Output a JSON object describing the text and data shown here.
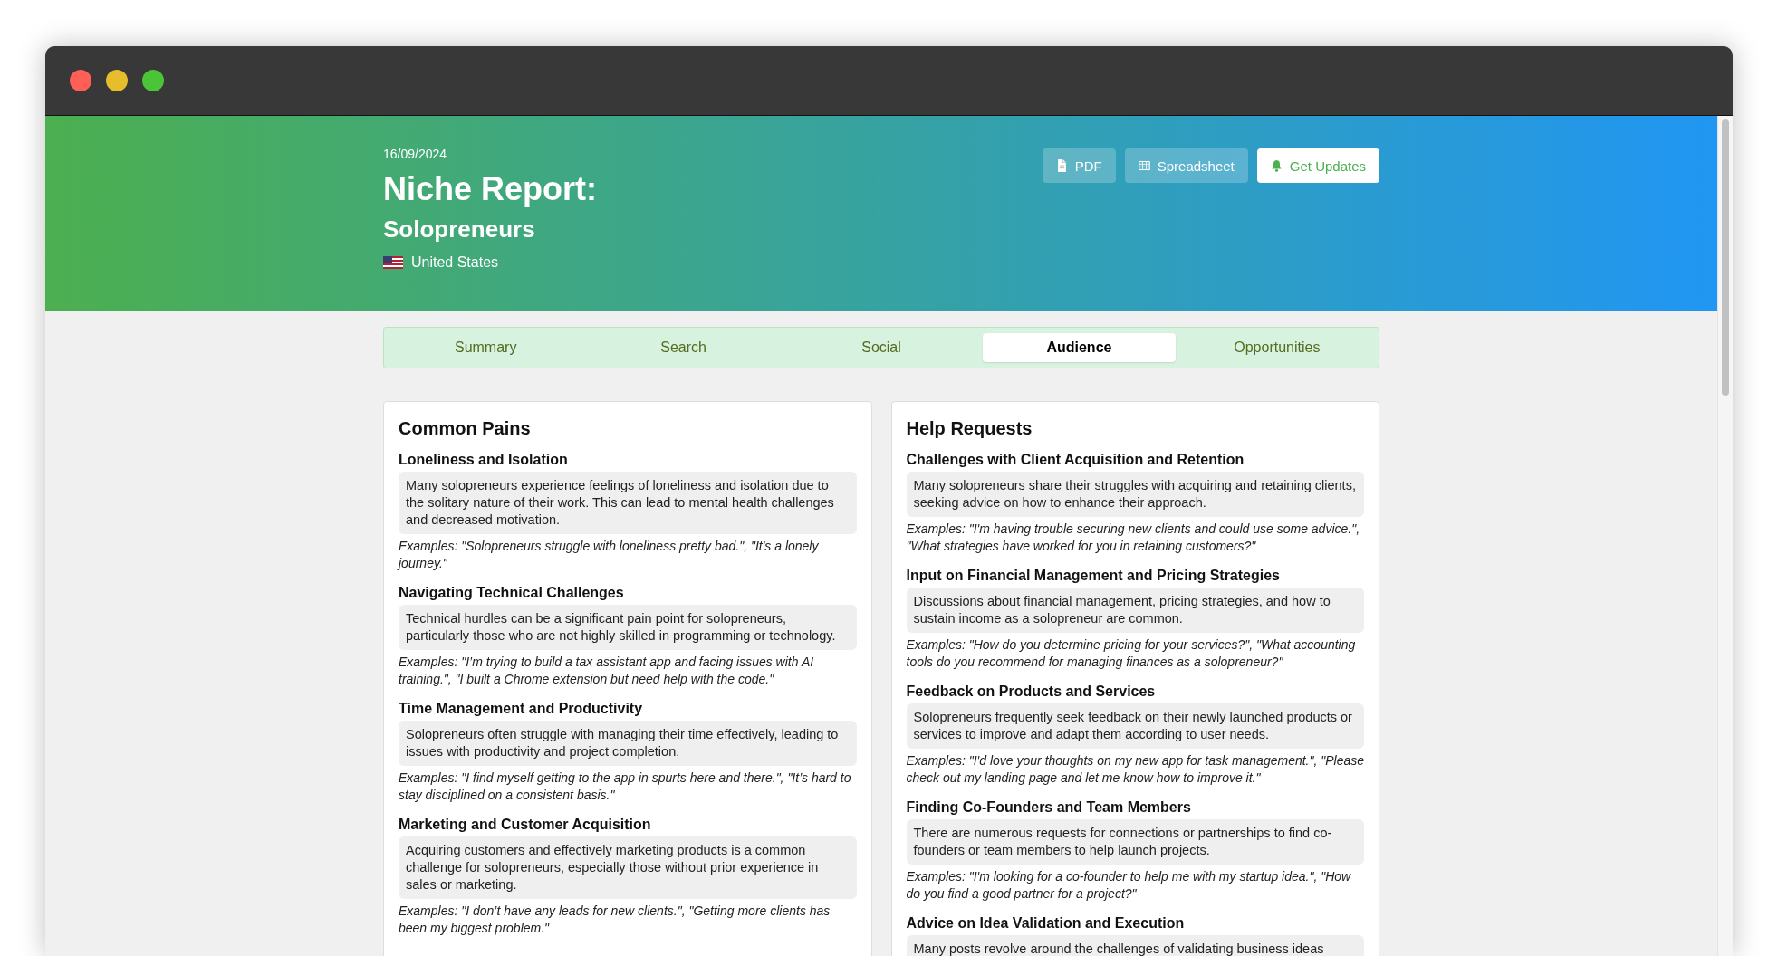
{
  "window": {
    "controls": [
      {
        "kind": "close"
      },
      {
        "kind": "minimize"
      },
      {
        "kind": "zoom"
      }
    ]
  },
  "header": {
    "date": "16/09/2024",
    "title": "Niche Report:",
    "subtitle": "Solopreneurs",
    "country": "United States",
    "buttons": [
      {
        "label": "PDF",
        "kind": "pdf"
      },
      {
        "label": "Spreadsheet",
        "kind": "spreadsheet"
      },
      {
        "label": "Get Updates",
        "kind": "updates"
      }
    ]
  },
  "tabs": [
    {
      "label": "Summary",
      "selected": false
    },
    {
      "label": "Search",
      "selected": false
    },
    {
      "label": "Social",
      "selected": false
    },
    {
      "label": "Audience",
      "selected": true
    },
    {
      "label": "Opportunities",
      "selected": false
    }
  ],
  "sections": [
    {
      "title": "Common Pains",
      "items": [
        {
          "title": "Loneliness and Isolation",
          "description": "Many solopreneurs experience feelings of loneliness and isolation due to the solitary nature of their work. This can lead to mental health challenges and decreased motivation.",
          "examples": "Examples: \"Solopreneurs struggle with loneliness pretty bad.\", \"It's a lonely journey.\""
        },
        {
          "title": "Navigating Technical Challenges",
          "description": "Technical hurdles can be a significant pain point for solopreneurs, particularly those who are not highly skilled in programming or technology.",
          "examples": "Examples: \"I’m trying to build a tax assistant app and facing issues with AI training.\", \"I built a Chrome extension but need help with the code.\""
        },
        {
          "title": "Time Management and Productivity",
          "description": "Solopreneurs often struggle with managing their time effectively, leading to issues with productivity and project completion.",
          "examples": "Examples: \"I find myself getting to the app in spurts here and there.\", \"It’s hard to stay disciplined on a consistent basis.\""
        },
        {
          "title": "Marketing and Customer Acquisition",
          "description": "Acquiring customers and effectively marketing products is a common challenge for solopreneurs, especially those without prior experience in sales or marketing.",
          "examples": "Examples: \"I don’t have any leads for new clients.\", \"Getting more clients has been my biggest problem.\""
        }
      ]
    },
    {
      "title": "Help Requests",
      "items": [
        {
          "title": "Challenges with Client Acquisition and Retention",
          "description": "Many solopreneurs share their struggles with acquiring and retaining clients, seeking advice on how to enhance their approach.",
          "examples": "Examples: \"I'm having trouble securing new clients and could use some advice.\", \"What strategies have worked for you in retaining customers?\""
        },
        {
          "title": "Input on Financial Management and Pricing Strategies",
          "description": "Discussions about financial management, pricing strategies, and how to sustain income as a solopreneur are common.",
          "examples": "Examples: \"How do you determine pricing for your services?\", \"What accounting tools do you recommend for managing finances as a solopreneur?\""
        },
        {
          "title": "Feedback on Products and Services",
          "description": "Solopreneurs frequently seek feedback on their newly launched products or services to improve and adapt them according to user needs.",
          "examples": "Examples: \"I'd love your thoughts on my new app for task management.\", \"Please check out my landing page and let me know how to improve it.\""
        },
        {
          "title": "Finding Co-Founders and Team Members",
          "description": "There are numerous requests for connections or partnerships to find co-founders or team members to help launch projects.",
          "examples": "Examples: \"I'm looking for a co-founder to help me with my startup idea.\", \"How do you find a good partner for a project?\""
        },
        {
          "title": "Advice on Idea Validation and Execution",
          "description": "Many posts revolve around the challenges of validating business ideas"
        }
      ]
    }
  ]
}
